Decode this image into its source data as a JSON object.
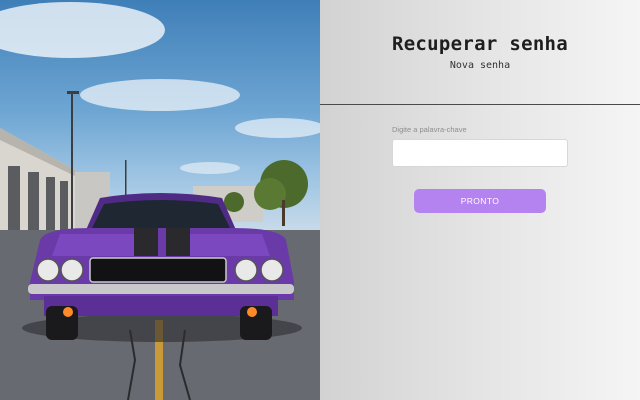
{
  "form": {
    "title": "Recuperar senha",
    "subtitle": "Nova senha",
    "field_label": "Digite a palavra-chave",
    "field_value": "",
    "submit_label": "PRONTO"
  },
  "colors": {
    "button": "#b583f0",
    "panel": "#e4e4e4",
    "car": "#6a3aa8"
  }
}
